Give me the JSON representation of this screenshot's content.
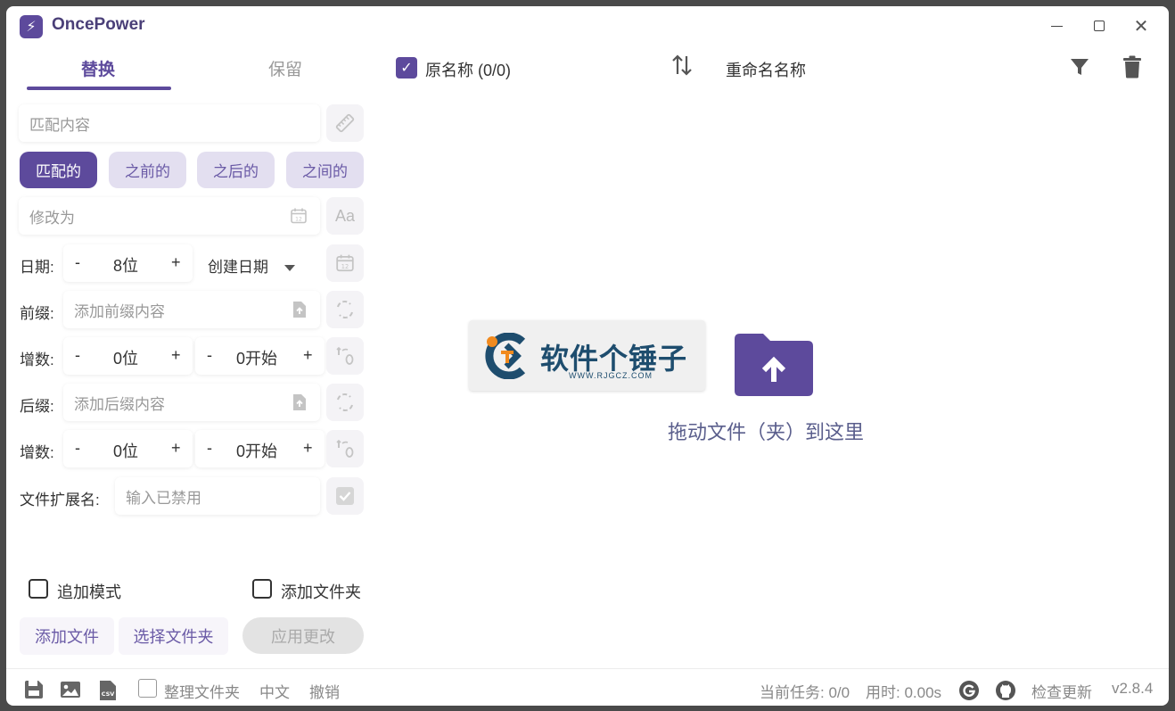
{
  "app": {
    "title": "OncePower",
    "logo_glyph": "⚡"
  },
  "tabs": {
    "replace": "替换",
    "keep": "保留"
  },
  "match": {
    "placeholder": "匹配内容"
  },
  "modes": [
    "匹配的",
    "之前的",
    "之后的",
    "之间的"
  ],
  "modify": {
    "placeholder": "修改为"
  },
  "date": {
    "label": "日期:",
    "minus": "-",
    "value": "8位",
    "plus": "+",
    "type": "创建日期"
  },
  "prefix": {
    "label": "前缀:",
    "placeholder": "添加前缀内容"
  },
  "increment1": {
    "label": "增数:",
    "digits": "0位",
    "start": "0开始",
    "minus": "-",
    "plus": "+"
  },
  "suffix": {
    "label": "后缀:",
    "placeholder": "添加后缀内容"
  },
  "increment2": {
    "label": "增数:",
    "digits": "0位",
    "start": "0开始",
    "minus": "-",
    "plus": "+"
  },
  "extension": {
    "label": "文件扩展名:",
    "placeholder": "输入已禁用"
  },
  "options": {
    "append_mode": "追加模式",
    "add_folder": "添加文件夹"
  },
  "actions": {
    "add_file": "添加文件",
    "select_folder": "选择文件夹",
    "apply": "应用更改"
  },
  "list_header": {
    "original": "原名称 (0/0)",
    "renamed": "重命名名称"
  },
  "drop": {
    "text": "拖动文件（夹）到这里"
  },
  "watermark": {
    "text": "软件个锤子",
    "sub": "WWW.RJGCZ.COM"
  },
  "status": {
    "organize": "整理文件夹",
    "language": "中文",
    "undo": "撤销",
    "task": "当前任务: 0/0",
    "time": "用时: 0.00s",
    "check_update": "检查更新",
    "version": "v2.8.4"
  },
  "colors": {
    "accent": "#5d4a9c",
    "accent_light": "#e3dff0"
  }
}
